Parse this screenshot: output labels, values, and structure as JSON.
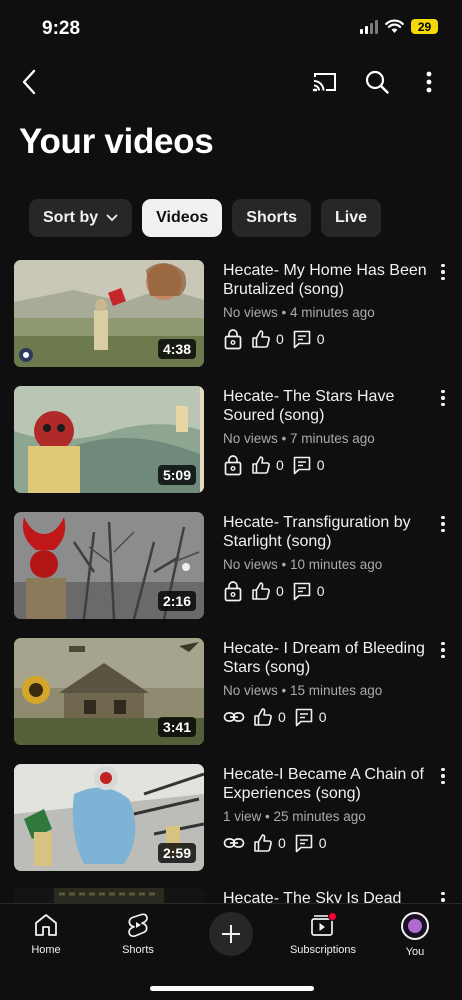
{
  "status_bar": {
    "time": "9:28",
    "battery": "29"
  },
  "app_bar": {
    "back_icon": "back-arrow-icon",
    "cast_icon": "cast-icon",
    "search_icon": "search-icon",
    "more_icon": "more-vertical-icon"
  },
  "page": {
    "title": "Your videos"
  },
  "filters": [
    {
      "label": "Sort by",
      "active": false,
      "has_dropdown": true
    },
    {
      "label": "Videos",
      "active": true
    },
    {
      "label": "Shorts",
      "active": false
    },
    {
      "label": "Live",
      "active": false
    }
  ],
  "videos": [
    {
      "title": "Hecate- My Home Has Been Brutalized (song)",
      "meta": "No views • 4 minutes ago",
      "duration": "4:38",
      "visibility": "private",
      "likes": "0",
      "comments": "0"
    },
    {
      "title": "Hecate- The Stars Have Soured (song)",
      "meta": "No views • 7 minutes ago",
      "duration": "5:09",
      "visibility": "private",
      "likes": "0",
      "comments": "0"
    },
    {
      "title": "Hecate- Transfiguration by Starlight (song)",
      "meta": "No views • 10 minutes ago",
      "duration": "2:16",
      "visibility": "private",
      "likes": "0",
      "comments": "0"
    },
    {
      "title": "Hecate- I Dream of Bleeding Stars (song)",
      "meta": "No views • 15 minutes ago",
      "duration": "3:41",
      "visibility": "unlisted",
      "likes": "0",
      "comments": "0"
    },
    {
      "title": "Hecate-I Became A Chain of Experiences (song)",
      "meta": "1 view • 25 minutes ago",
      "duration": "2:59",
      "visibility": "unlisted",
      "likes": "0",
      "comments": "0"
    },
    {
      "title": "Hecate- The Sky Is Dead",
      "meta": "",
      "duration": "",
      "visibility": "",
      "likes": "",
      "comments": ""
    }
  ],
  "bottom_nav": {
    "home": "Home",
    "shorts": "Shorts",
    "subscriptions": "Subscriptions",
    "you": "You"
  },
  "colors": {
    "background": "#0f0f0f",
    "chip": "#272727",
    "chip_active": "#f1f1f1",
    "notification_dot": "#ff0033",
    "battery": "#f5d90a"
  }
}
